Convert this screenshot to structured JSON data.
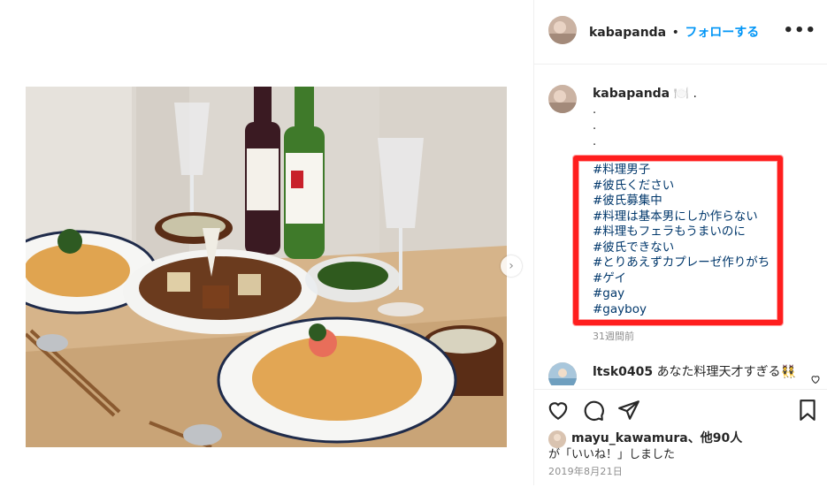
{
  "post": {
    "username": "kabapanda",
    "separator": "•",
    "follow_label": "フォローする",
    "more_label": "•••"
  },
  "caption": {
    "username": "kabapanda",
    "emoji": "🍽️",
    "trailing": ".",
    "dots": [
      ".",
      ".",
      "."
    ],
    "hashtags": [
      "#料理男子",
      "#彼氏ください",
      "#彼氏募集中",
      "#料理は基本男にしか作らない",
      "#料理もフェラもうまいのに",
      "#彼氏できない",
      "#とりあえずカプレーゼ作りがち",
      "#ゲイ",
      "#gay",
      "#gayboy"
    ],
    "time": "31週間前"
  },
  "comment": {
    "username": "ltsk0405",
    "text": "あなた料理天才すぎる👯"
  },
  "likes": {
    "username": "mayu_kawamura",
    "suffix": "、他90人",
    "line2": "が「いいね！」しました"
  },
  "date": "2019年8月21日",
  "icons": {
    "heart": "heart-icon",
    "comment": "comment-icon",
    "share": "share-icon",
    "save": "bookmark-icon",
    "next": "chevron-right-icon",
    "comment_like": "small-heart-icon"
  },
  "colors": {
    "link": "#0095f6",
    "hashtag": "#00376b",
    "highlight": "#ff1e1e",
    "muted": "#8e8e8e"
  }
}
